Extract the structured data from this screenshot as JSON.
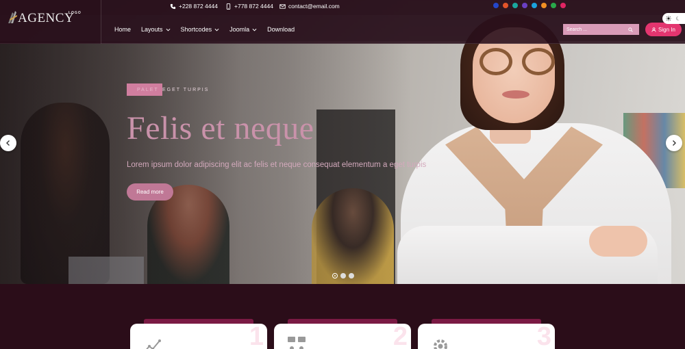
{
  "topbar": {
    "phone1": "+228 872 4444",
    "phone2": "+778 872 4444",
    "email": "contact@email.com",
    "theme_colors": [
      "#2446c9",
      "#e2542a",
      "#1aa79e",
      "#6a3fc2",
      "#1ba2dc",
      "#f08f23",
      "#29a74a",
      "#e02463"
    ]
  },
  "brand": {
    "name": "AGENCY",
    "sup": "LOGO"
  },
  "nav": {
    "items": [
      {
        "label": "Home"
      },
      {
        "label": "Layouts"
      },
      {
        "label": "Shortcodes"
      },
      {
        "label": "Joomla"
      },
      {
        "label": "Download"
      }
    ],
    "search_placeholder": "Search ...",
    "signin_label": "Sign In"
  },
  "hero": {
    "badge_highlight": "PALET",
    "badge_rest": "EGET TURPIS",
    "title": "Felis et neque",
    "text": "Lorem ipsum dolor adipiscing elit ac felis et neque consequat elementum a eget turpis",
    "button": "Read more",
    "slide_active": 1,
    "slide_count": 3
  },
  "features": {
    "cards": [
      {
        "number": "1",
        "icon": "chart-icon"
      },
      {
        "number": "2",
        "icon": "users-chat-icon"
      },
      {
        "number": "3",
        "icon": "gear-icon"
      }
    ]
  },
  "colors": {
    "accent": "#e3356f",
    "dark_bg": "#2b0d19",
    "title_pink": "#c992aa"
  }
}
